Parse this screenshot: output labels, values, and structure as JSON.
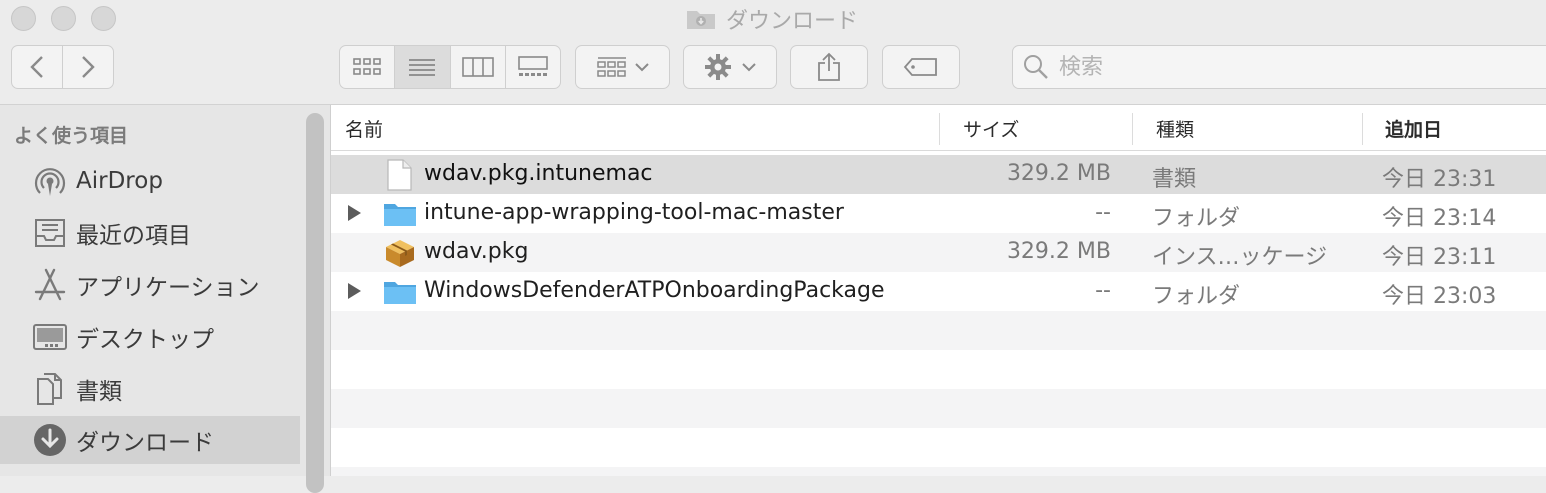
{
  "window": {
    "title": "ダウンロード",
    "folder_icon": "downloads-folder-icon"
  },
  "toolbar": {
    "back_icon": "chevron-left-icon",
    "forward_icon": "chevron-right-icon",
    "view_modes": [
      "icon-view",
      "list-view",
      "column-view",
      "gallery-view"
    ],
    "active_view": "list-view",
    "group_icon": "group-grid-icon",
    "action_icon": "gear-icon",
    "share_icon": "share-icon",
    "tag_icon": "tag-icon"
  },
  "search": {
    "placeholder": "検索",
    "value": ""
  },
  "sidebar": {
    "heading": "よく使う項目",
    "items": [
      {
        "label": "AirDrop",
        "icon": "airdrop-icon",
        "selected": false
      },
      {
        "label": "最近の項目",
        "icon": "recents-icon",
        "selected": false
      },
      {
        "label": "アプリケーション",
        "icon": "applications-icon",
        "selected": false
      },
      {
        "label": "デスクトップ",
        "icon": "desktop-icon",
        "selected": false
      },
      {
        "label": "書類",
        "icon": "documents-icon",
        "selected": false
      },
      {
        "label": "ダウンロード",
        "icon": "downloads-icon",
        "selected": true
      }
    ]
  },
  "list": {
    "columns": {
      "name": "名前",
      "size": "サイズ",
      "kind": "種類",
      "date_added": "追加日"
    },
    "rows": [
      {
        "name": "wdav.pkg.intunemac",
        "size": "329.2 MB",
        "kind": "書類",
        "date": "今日 23:31",
        "icon": "document-icon",
        "expandable": false,
        "selected": true
      },
      {
        "name": "intune-app-wrapping-tool-mac-master",
        "size": "--",
        "kind": "フォルダ",
        "date": "今日 23:14",
        "icon": "folder-icon",
        "expandable": true,
        "selected": false
      },
      {
        "name": "wdav.pkg",
        "size": "329.2 MB",
        "kind": "インス…ッケージ",
        "date": "今日 23:11",
        "icon": "package-icon",
        "expandable": false,
        "selected": false
      },
      {
        "name": "WindowsDefenderATPOnboardingPackage",
        "size": "--",
        "kind": "フォルダ",
        "date": "今日 23:03",
        "icon": "folder-icon",
        "expandable": true,
        "selected": false
      }
    ]
  },
  "colors": {
    "folder_blue": "#5fb7ee",
    "selection_gray": "#dcdcdc",
    "sidebar_bg": "#e6e6e6"
  }
}
